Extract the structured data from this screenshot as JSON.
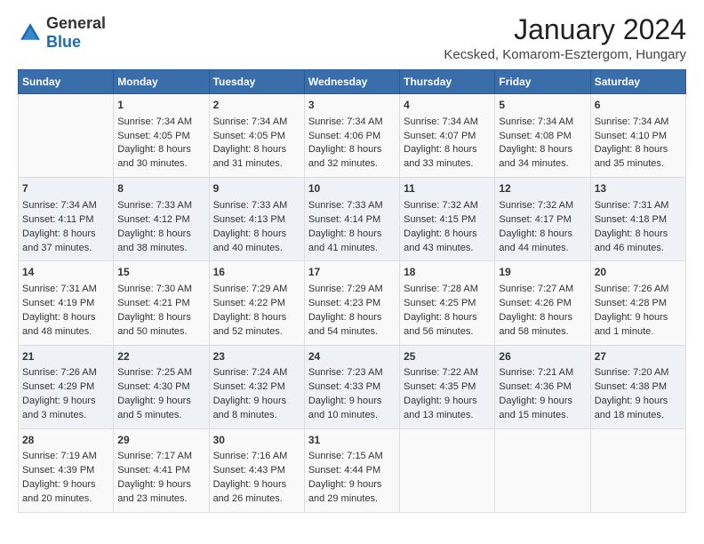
{
  "header": {
    "logo_general": "General",
    "logo_blue": "Blue",
    "title": "January 2024",
    "subtitle": "Kecsked, Komarom-Esztergom, Hungary"
  },
  "days_of_week": [
    "Sunday",
    "Monday",
    "Tuesday",
    "Wednesday",
    "Thursday",
    "Friday",
    "Saturday"
  ],
  "weeks": [
    [
      {
        "day": "",
        "info": ""
      },
      {
        "day": "1",
        "info": "Sunrise: 7:34 AM\nSunset: 4:05 PM\nDaylight: 8 hours\nand 30 minutes."
      },
      {
        "day": "2",
        "info": "Sunrise: 7:34 AM\nSunset: 4:05 PM\nDaylight: 8 hours\nand 31 minutes."
      },
      {
        "day": "3",
        "info": "Sunrise: 7:34 AM\nSunset: 4:06 PM\nDaylight: 8 hours\nand 32 minutes."
      },
      {
        "day": "4",
        "info": "Sunrise: 7:34 AM\nSunset: 4:07 PM\nDaylight: 8 hours\nand 33 minutes."
      },
      {
        "day": "5",
        "info": "Sunrise: 7:34 AM\nSunset: 4:08 PM\nDaylight: 8 hours\nand 34 minutes."
      },
      {
        "day": "6",
        "info": "Sunrise: 7:34 AM\nSunset: 4:10 PM\nDaylight: 8 hours\nand 35 minutes."
      }
    ],
    [
      {
        "day": "7",
        "info": "Sunrise: 7:34 AM\nSunset: 4:11 PM\nDaylight: 8 hours\nand 37 minutes."
      },
      {
        "day": "8",
        "info": "Sunrise: 7:33 AM\nSunset: 4:12 PM\nDaylight: 8 hours\nand 38 minutes."
      },
      {
        "day": "9",
        "info": "Sunrise: 7:33 AM\nSunset: 4:13 PM\nDaylight: 8 hours\nand 40 minutes."
      },
      {
        "day": "10",
        "info": "Sunrise: 7:33 AM\nSunset: 4:14 PM\nDaylight: 8 hours\nand 41 minutes."
      },
      {
        "day": "11",
        "info": "Sunrise: 7:32 AM\nSunset: 4:15 PM\nDaylight: 8 hours\nand 43 minutes."
      },
      {
        "day": "12",
        "info": "Sunrise: 7:32 AM\nSunset: 4:17 PM\nDaylight: 8 hours\nand 44 minutes."
      },
      {
        "day": "13",
        "info": "Sunrise: 7:31 AM\nSunset: 4:18 PM\nDaylight: 8 hours\nand 46 minutes."
      }
    ],
    [
      {
        "day": "14",
        "info": "Sunrise: 7:31 AM\nSunset: 4:19 PM\nDaylight: 8 hours\nand 48 minutes."
      },
      {
        "day": "15",
        "info": "Sunrise: 7:30 AM\nSunset: 4:21 PM\nDaylight: 8 hours\nand 50 minutes."
      },
      {
        "day": "16",
        "info": "Sunrise: 7:29 AM\nSunset: 4:22 PM\nDaylight: 8 hours\nand 52 minutes."
      },
      {
        "day": "17",
        "info": "Sunrise: 7:29 AM\nSunset: 4:23 PM\nDaylight: 8 hours\nand 54 minutes."
      },
      {
        "day": "18",
        "info": "Sunrise: 7:28 AM\nSunset: 4:25 PM\nDaylight: 8 hours\nand 56 minutes."
      },
      {
        "day": "19",
        "info": "Sunrise: 7:27 AM\nSunset: 4:26 PM\nDaylight: 8 hours\nand 58 minutes."
      },
      {
        "day": "20",
        "info": "Sunrise: 7:26 AM\nSunset: 4:28 PM\nDaylight: 9 hours\nand 1 minute."
      }
    ],
    [
      {
        "day": "21",
        "info": "Sunrise: 7:26 AM\nSunset: 4:29 PM\nDaylight: 9 hours\nand 3 minutes."
      },
      {
        "day": "22",
        "info": "Sunrise: 7:25 AM\nSunset: 4:30 PM\nDaylight: 9 hours\nand 5 minutes."
      },
      {
        "day": "23",
        "info": "Sunrise: 7:24 AM\nSunset: 4:32 PM\nDaylight: 9 hours\nand 8 minutes."
      },
      {
        "day": "24",
        "info": "Sunrise: 7:23 AM\nSunset: 4:33 PM\nDaylight: 9 hours\nand 10 minutes."
      },
      {
        "day": "25",
        "info": "Sunrise: 7:22 AM\nSunset: 4:35 PM\nDaylight: 9 hours\nand 13 minutes."
      },
      {
        "day": "26",
        "info": "Sunrise: 7:21 AM\nSunset: 4:36 PM\nDaylight: 9 hours\nand 15 minutes."
      },
      {
        "day": "27",
        "info": "Sunrise: 7:20 AM\nSunset: 4:38 PM\nDaylight: 9 hours\nand 18 minutes."
      }
    ],
    [
      {
        "day": "28",
        "info": "Sunrise: 7:19 AM\nSunset: 4:39 PM\nDaylight: 9 hours\nand 20 minutes."
      },
      {
        "day": "29",
        "info": "Sunrise: 7:17 AM\nSunset: 4:41 PM\nDaylight: 9 hours\nand 23 minutes."
      },
      {
        "day": "30",
        "info": "Sunrise: 7:16 AM\nSunset: 4:43 PM\nDaylight: 9 hours\nand 26 minutes."
      },
      {
        "day": "31",
        "info": "Sunrise: 7:15 AM\nSunset: 4:44 PM\nDaylight: 9 hours\nand 29 minutes."
      },
      {
        "day": "",
        "info": ""
      },
      {
        "day": "",
        "info": ""
      },
      {
        "day": "",
        "info": ""
      }
    ]
  ]
}
